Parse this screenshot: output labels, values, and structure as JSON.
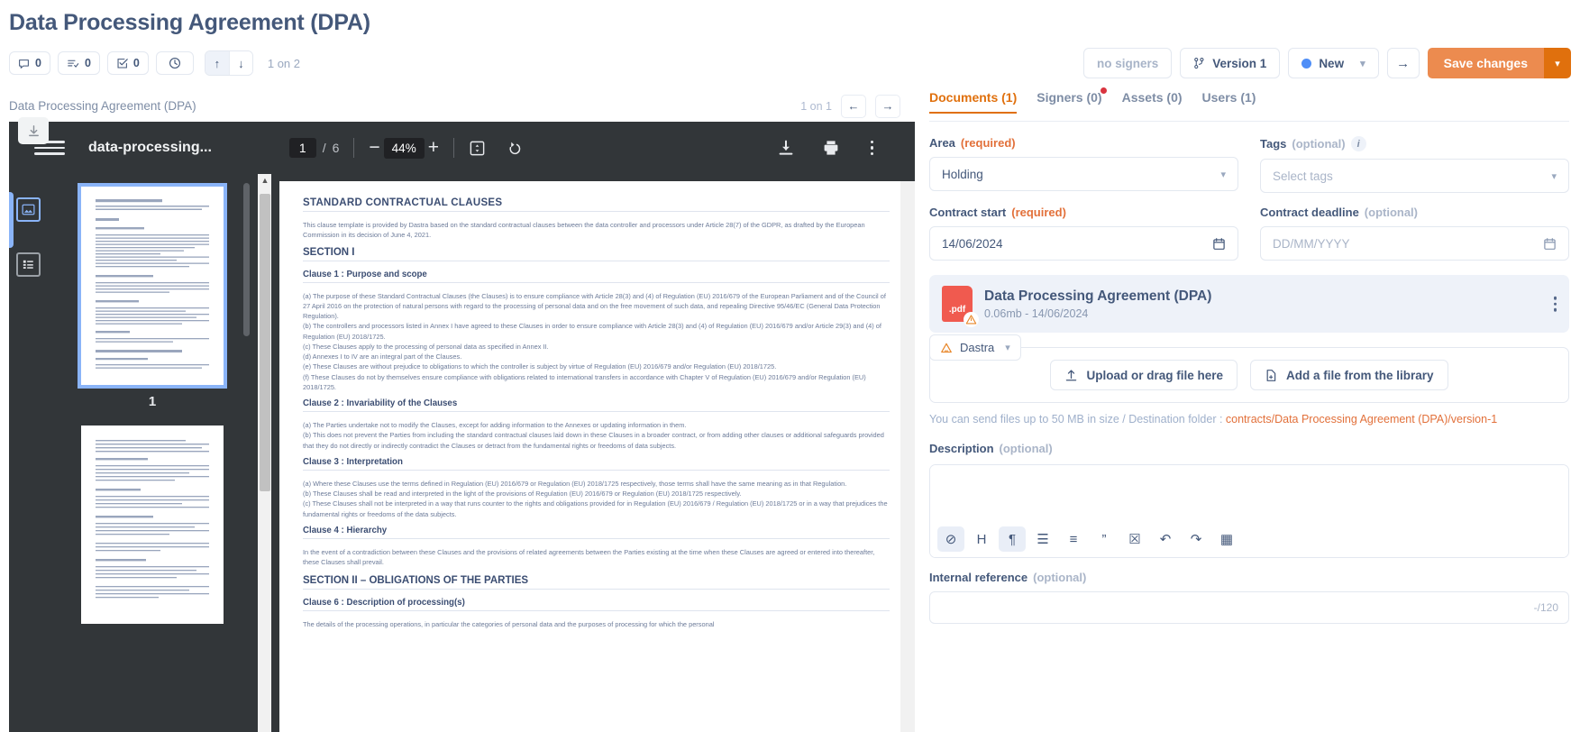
{
  "header": {
    "title": "Data Processing Agreement (DPA)",
    "stats": [
      {
        "icon": "comment-icon",
        "value": "0"
      },
      {
        "icon": "task-list-icon",
        "value": "0"
      },
      {
        "icon": "checkbox-icon",
        "value": "0"
      },
      {
        "icon": "history-clock-icon",
        "value": ""
      }
    ],
    "nav_up": "↑",
    "nav_down": "↓",
    "counter": "1 on 2",
    "signers_label": "no signers",
    "version_label": "Version 1",
    "status_label": "New",
    "status_color": "#4f8ef7",
    "next_arrow": "→",
    "save_label": "Save changes",
    "save_caret": "⌄"
  },
  "left_panel": {
    "doc_name": "Data Processing Agreement (DPA)",
    "counter": "1 on 1",
    "prev_arrow": "←",
    "next_arrow": "→"
  },
  "pdf_toolbar": {
    "filename": "data-processing...",
    "current_page": "1",
    "page_sep": "/",
    "total_pages": "6",
    "zoom_out": "−",
    "zoom_level": "44%",
    "zoom_in": "+",
    "fit_page_icon": "fit-page-icon",
    "rotate_icon": "rotate-icon",
    "download_icon": "download-icon",
    "print_icon": "print-icon",
    "more_icon": "more-options-icon"
  },
  "thumbnails": {
    "page_label": "1"
  },
  "document": {
    "title": "STANDARD CONTRACTUAL CLAUSES",
    "intro": "This clause template is provided by Dastra based on the standard contractual clauses between the data controller and processors under Article 28(7) of the GDPR, as drafted by the European Commission in its decision of June 4, 2021.",
    "sections": [
      {
        "heading": "SECTION I",
        "clauses": [
          {
            "title": "Clause 1 : Purpose and scope",
            "body": "(a) The purpose of these Standard Contractual Clauses (the Clauses) is to ensure compliance with Article 28(3) and (4) of Regulation (EU) 2016/679 of the European Parliament and of the Council of 27 April 2016 on the protection of natural persons with regard to the processing of personal data and on the free movement of such data, and repealing Directive 95/46/EC (General Data Protection Regulation).\n(b) The controllers and processors listed in Annex I have agreed to these Clauses in order to ensure compliance with Article 28(3) and (4) of Regulation (EU) 2016/679 and/or Article 29(3) and (4) of Regulation (EU) 2018/1725.\n(c) These Clauses apply to the processing of personal data as specified in Annex II.\n(d) Annexes I to IV are an integral part of the Clauses.\n(e) These Clauses are without prejudice to obligations to which the controller is subject by virtue of Regulation (EU) 2016/679 and/or Regulation (EU) 2018/1725.\n(f) These Clauses do not by themselves ensure compliance with obligations related to international transfers in accordance with Chapter V of Regulation (EU) 2016/679 and/or Regulation (EU) 2018/1725."
          },
          {
            "title": "Clause 2 : Invariability of the Clauses",
            "body": "(a) The Parties undertake not to modify the Clauses, except for adding information to the Annexes or updating information in them.\n(b) This does not prevent the Parties from including the standard contractual clauses laid down in these Clauses in a broader contract, or from adding other clauses or additional safeguards provided that they do not directly or indirectly contradict the Clauses or detract from the fundamental rights or freedoms of data subjects."
          },
          {
            "title": "Clause 3 : Interpretation",
            "body": "(a) Where these Clauses use the terms defined in Regulation (EU) 2016/679 or Regulation (EU) 2018/1725 respectively, those terms shall have the same meaning as in that Regulation.\n(b) These Clauses shall be read and interpreted in the light of the provisions of Regulation (EU) 2016/679 or Regulation (EU) 2018/1725 respectively.\n(c) These Clauses shall not be interpreted in a way that runs counter to the rights and obligations provided for in Regulation (EU) 2016/679 / Regulation (EU) 2018/1725 or in a way that prejudices the fundamental rights or freedoms of the data subjects."
          },
          {
            "title": "Clause 4 : Hierarchy",
            "body": "In the event of a contradiction between these Clauses and the provisions of related agreements between the Parties existing at the time when these Clauses are agreed or entered into thereafter, these Clauses shall prevail."
          }
        ]
      },
      {
        "heading": "SECTION II – OBLIGATIONS OF THE PARTIES",
        "clauses": [
          {
            "title": "Clause 6 : Description of processing(s)",
            "body": "The details of the processing operations, in particular the categories of personal data and the purposes of processing for which the personal"
          }
        ]
      }
    ]
  },
  "tabs": [
    {
      "label": "Documents (1)",
      "active": true,
      "badge": false
    },
    {
      "label": "Signers (0)",
      "active": false,
      "badge": true
    },
    {
      "label": "Assets (0)",
      "active": false,
      "badge": false
    },
    {
      "label": "Users (1)",
      "active": false,
      "badge": false
    }
  ],
  "form": {
    "area": {
      "label": "Area",
      "requirement": "(required)",
      "value": "Holding"
    },
    "tags": {
      "label": "Tags",
      "requirement": "(optional)",
      "placeholder": "Select tags",
      "info_icon": "info-icon"
    },
    "contract_start": {
      "label": "Contract start",
      "requirement": "(required)",
      "value": "14/06/2024",
      "icon": "calendar-icon"
    },
    "contract_deadline": {
      "label": "Contract deadline",
      "requirement": "(optional)",
      "placeholder": "DD/MM/YYYY",
      "icon": "calendar-icon"
    },
    "file_card": {
      "badge": ".pdf",
      "name": "Data Processing Agreement (DPA)",
      "meta": "0.06mb - 14/06/2024"
    },
    "dropzone": {
      "source_label": "Dastra",
      "upload_label": "Upload or drag file here",
      "library_label": "Add a file from the library"
    },
    "hint_prefix": "You can send files up to 50 MB in size / Destination folder : ",
    "hint_path": "contracts/Data Processing Agreement (DPA)/version-1",
    "description": {
      "label": "Description",
      "requirement": "(optional)"
    },
    "editor_buttons": [
      {
        "icon": "link-icon",
        "glyph": "⊘",
        "active": true
      },
      {
        "icon": "heading-icon",
        "glyph": "H",
        "active": false
      },
      {
        "icon": "paragraph-icon",
        "glyph": "¶",
        "active": true
      },
      {
        "icon": "bullet-list-icon",
        "glyph": "☰",
        "active": false
      },
      {
        "icon": "numbered-list-icon",
        "glyph": "≡",
        "active": false
      },
      {
        "icon": "quote-icon",
        "glyph": "”",
        "active": false
      },
      {
        "icon": "image-icon",
        "glyph": "☒",
        "active": false
      },
      {
        "icon": "undo-icon",
        "glyph": "↶",
        "active": false
      },
      {
        "icon": "redo-icon",
        "glyph": "↷",
        "active": false
      },
      {
        "icon": "table-icon",
        "glyph": "▦",
        "active": false
      }
    ],
    "internal_reference": {
      "label": "Internal reference",
      "requirement": "(optional)",
      "counter": "-/120"
    }
  }
}
